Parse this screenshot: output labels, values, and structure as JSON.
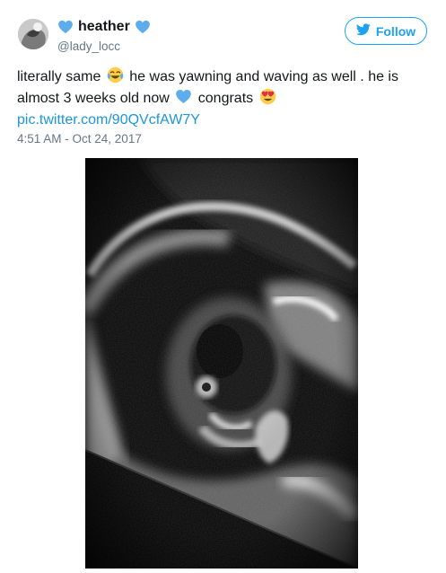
{
  "user": {
    "display_name": "heather",
    "handle": "@lady_locc",
    "avatar_icon": "avatar-photo"
  },
  "follow_button": {
    "label": "Follow",
    "icon": "twitter-bird-icon",
    "color": "#1da1f2"
  },
  "tweet": {
    "line1_part1": "literally same",
    "line1_emoji": "face-with-tears-of-joy",
    "line1_part2": "he was yawning and waving as well . he is",
    "line2_part1": "almost 3 weeks old now",
    "line2_emoji": "blue-heart",
    "line2_part2": "congrats",
    "line2_emoji2": "heart-eyes",
    "link_text": "pic.twitter.com/90QVcfAW7Y",
    "timestamp": "4:51 AM - Oct 24, 2017"
  },
  "media": {
    "type": "ultrasound-image"
  },
  "colors": {
    "text": "#14171a",
    "secondary": "#657786",
    "link": "#1b95e0",
    "heart": "#5dadec"
  }
}
